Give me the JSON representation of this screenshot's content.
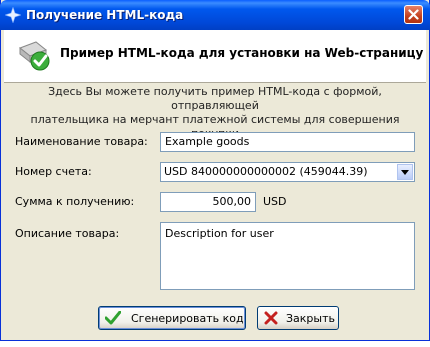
{
  "window": {
    "title": "Получение HTML-кода"
  },
  "header": {
    "title": "Пример HTML-кода для установки на Web-страницу"
  },
  "intro": {
    "line1": "Здесь Вы можете получить пример HTML-кода с формой, отправляющей",
    "line2": "плательщика на мерчант платежной системы для совершения покупки"
  },
  "form": {
    "product_name": {
      "label": "Наименование товара:",
      "value": "Example goods"
    },
    "account": {
      "label": "Номер счета:",
      "value": "USD 840000000000002 (459044.39)"
    },
    "amount": {
      "label": "Сумма к получению:",
      "value": "500,00",
      "currency": "USD"
    },
    "description": {
      "label": "Описание товара:",
      "value": "Description for user"
    }
  },
  "buttons": {
    "generate": "Сгенерировать код",
    "close": "Закрыть"
  },
  "colors": {
    "titlebar": "#0054e3",
    "dialog_bg": "#ece9d8",
    "close_red": "#c4411f",
    "accent_green": "#2fa12f"
  }
}
